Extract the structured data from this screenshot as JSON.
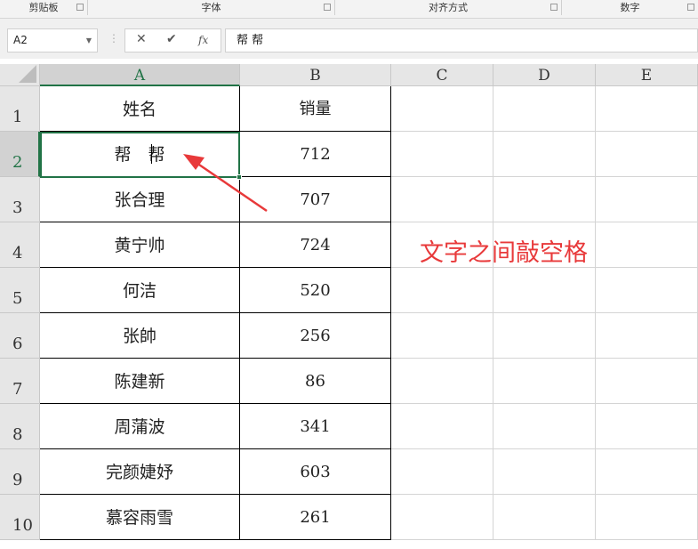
{
  "ribbon": {
    "groups": [
      "剪贴板",
      "字体",
      "对齐方式",
      "数字"
    ]
  },
  "formula_bar": {
    "name_box": "A2",
    "cancel": "✕",
    "enter": "✔",
    "fx": "fx",
    "content": "帮 帮"
  },
  "columns": [
    "A",
    "B",
    "C",
    "D",
    "E"
  ],
  "rows": [
    {
      "num": "1",
      "name": "姓名",
      "sales": "销量"
    },
    {
      "num": "2",
      "name": "帮　帮",
      "sales": "712"
    },
    {
      "num": "3",
      "name": "张合理",
      "sales": "707"
    },
    {
      "num": "4",
      "name": "黄宁帅",
      "sales": "724"
    },
    {
      "num": "5",
      "name": "何洁",
      "sales": "520"
    },
    {
      "num": "6",
      "name": "张帥",
      "sales": "256"
    },
    {
      "num": "7",
      "name": "陈建新",
      "sales": "86"
    },
    {
      "num": "8",
      "name": "周蒲波",
      "sales": "341"
    },
    {
      "num": "9",
      "name": "完颜婕妤",
      "sales": "603"
    },
    {
      "num": "10",
      "name": "慕容雨雪",
      "sales": "261"
    }
  ],
  "annotation": "文字之间敲空格",
  "colors": {
    "accent": "#217346",
    "annotation": "#e8393a"
  }
}
